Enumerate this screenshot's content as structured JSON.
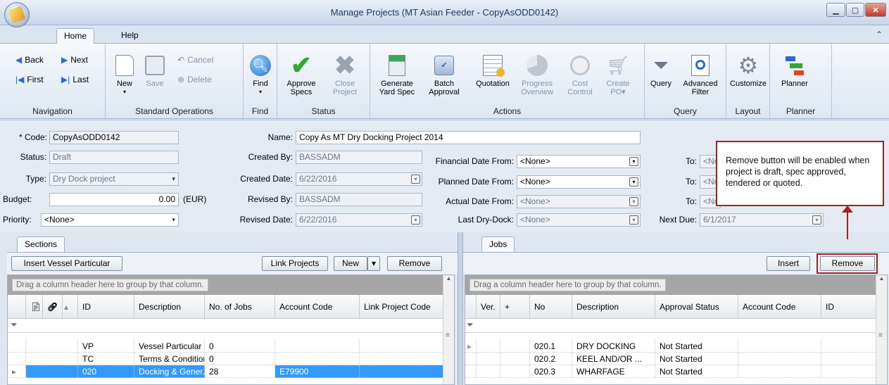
{
  "window": {
    "title": "Manage Projects (MT Asian Feeder - CopyAsODD0142)"
  },
  "ribbon_tabs": [
    "Home",
    "Help"
  ],
  "navigation": {
    "back": "Back",
    "next": "Next",
    "first": "First",
    "last": "Last",
    "group": "Navigation"
  },
  "standard_ops": {
    "new": "New",
    "save": "Save",
    "cancel": "Cancel",
    "delete": "Delete",
    "group": "Standard Operations"
  },
  "find": {
    "label": "Find",
    "group": "Find"
  },
  "status": {
    "approve1": "Approve",
    "approve2": "Specs",
    "close1": "Close",
    "close2": "Project",
    "group": "Status"
  },
  "actions": {
    "gen1": "Generate",
    "gen2": "Yard Spec",
    "batch1": "Batch",
    "batch2": "Approval",
    "quotation": "Quotation",
    "prog1": "Progress",
    "prog2": "Overview",
    "cost1": "Cost",
    "cost2": "Control",
    "po1": "Create",
    "po2": "PO▾",
    "group": "Actions"
  },
  "query": {
    "query": "Query",
    "adv1": "Advanced",
    "adv2": "Filter",
    "group": "Query"
  },
  "layout": {
    "customize": "Customize",
    "group": "Layout"
  },
  "planner": {
    "planner": "Planner",
    "group": "Planner"
  },
  "form": {
    "code_label": "* Code:",
    "code": "CopyAsODD0142",
    "status_label": "Status:",
    "status": "Draft",
    "type_label": "Type:",
    "type": "Dry Dock project",
    "budget_label": "Budget:",
    "budget": "0.00",
    "currency": "(EUR)",
    "priority_label": "Priority:",
    "priority": "<None>",
    "name_label": "Name:",
    "name": "Copy As MT Dry Docking Project 2014",
    "created_by_label": "Created By:",
    "created_by": "BASSADM",
    "created_date_label": "Created Date:",
    "created_date": "6/22/2016",
    "revised_by_label": "Revised By:",
    "revised_by": "BASSADM",
    "revised_date_label": "Revised Date:",
    "revised_date": "6/22/2016",
    "fin_from_label": "Financial Date From:",
    "fin_from": "<None>",
    "plan_from_label": "Planned Date From:",
    "plan_from": "<None>",
    "act_from_label": "Actual Date From:",
    "act_from": "<None>",
    "last_dd_label": "Last Dry-Dock:",
    "last_dd": "<None>",
    "to_label": "To:",
    "to_value": "<No",
    "next_due_label": "Next Due:",
    "next_due": "6/1/2017"
  },
  "callout": "Remove button will be enabled when project is draft, spec approved, tendered or quoted.",
  "sections": {
    "tab": "Sections",
    "insert_vp": "Insert Vessel Particular",
    "link_projects": "Link Projects",
    "new": "New",
    "remove": "Remove",
    "group_hint": "Drag a column header here to group by that column.",
    "headers": [
      "ID",
      "Description",
      "No. of Jobs",
      "Account Code",
      "Link Project Code"
    ],
    "rows": [
      {
        "id": "VP",
        "desc": "Vessel Particular",
        "jobs": "0",
        "acct": ""
      },
      {
        "id": "TC",
        "desc": "Terms & Conditions",
        "jobs": "0",
        "acct": ""
      },
      {
        "id": "020",
        "desc": "Docking & Gener...",
        "jobs": "28",
        "acct": "E79900"
      }
    ]
  },
  "jobs": {
    "tab": "Jobs",
    "insert": "Insert",
    "remove": "Remove",
    "group_hint": "Drag a column header here to group by that column.",
    "headers": [
      "Ver.",
      "+",
      "No",
      "Description",
      "Approval Status",
      "Account Code",
      "ID"
    ],
    "rows": [
      {
        "no": "020.1",
        "desc": "DRY DOCKING",
        "status": "Not Started"
      },
      {
        "no": "020.2",
        "desc": "KEEL AND/OR ...",
        "status": "Not Started"
      },
      {
        "no": "020.3",
        "desc": "WHARFAGE",
        "status": "Not Started"
      }
    ]
  }
}
